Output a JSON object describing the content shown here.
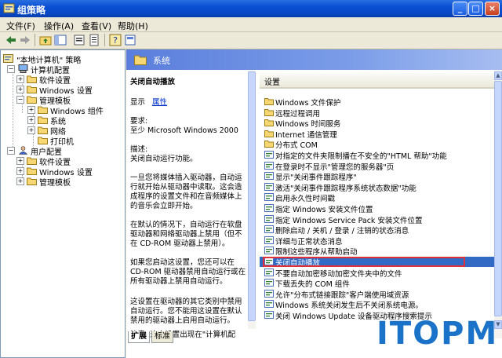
{
  "window": {
    "title": "组策略"
  },
  "menu": [
    "文件(F)",
    "操作(A)",
    "查看(V)",
    "帮助(H)"
  ],
  "toolbar_icons": [
    "back-icon",
    "forward-icon",
    "up-folder-icon",
    "show-tree-icon",
    "properties-icon",
    "export-icon",
    "help-icon",
    "view-icon"
  ],
  "tree": [
    {
      "label": "\"本地计算机\" 策略",
      "level": 0,
      "icon": "policy-icon",
      "expander": ""
    },
    {
      "label": "计算机配置",
      "level": 1,
      "icon": "computer-icon",
      "expander": "−"
    },
    {
      "label": "软件设置",
      "level": 2,
      "icon": "folder-icon",
      "expander": "+"
    },
    {
      "label": "Windows 设置",
      "level": 2,
      "icon": "folder-icon",
      "expander": "+"
    },
    {
      "label": "管理模板",
      "level": 2,
      "icon": "folder-icon",
      "expander": "−"
    },
    {
      "label": "Windows 组件",
      "level": 3,
      "icon": "folder-icon",
      "expander": "+"
    },
    {
      "label": "系统",
      "level": 3,
      "icon": "folder-icon",
      "expander": "+"
    },
    {
      "label": "网络",
      "level": 3,
      "icon": "folder-icon",
      "expander": "+"
    },
    {
      "label": "打印机",
      "level": 3,
      "icon": "folder-icon",
      "expander": ""
    },
    {
      "label": "用户配置",
      "level": 1,
      "icon": "user-icon",
      "expander": "−"
    },
    {
      "label": "软件设置",
      "level": 2,
      "icon": "folder-icon",
      "expander": "+"
    },
    {
      "label": "Windows 设置",
      "level": 2,
      "icon": "folder-icon",
      "expander": "+"
    },
    {
      "label": "管理模板",
      "level": 2,
      "icon": "folder-icon",
      "expander": "+"
    }
  ],
  "header": {
    "title": "系统"
  },
  "description": {
    "title": "关闭自动播放",
    "show_label": "显示",
    "properties_link": "属性",
    "requirements_label": "要求:",
    "requirements_value": "至少 Microsoft Windows 2000",
    "desc_label": "描述:",
    "desc_first": "关闭自动运行功能。",
    "para1": "一旦您将媒体插入驱动器，自动运行就开始从驱动器中读取。这会造成程序的设置文件和在音频媒体上的音乐会立即开始。",
    "para2": "在默认的情况下，自动运行在软盘驱动器和网络驱动器上禁用（但不在 CD-ROM 驱动器上禁用）。",
    "para3": "如果您启动这设置，您还可以在 CD-ROM 驱动器禁用自动运行或在所有驱动器上禁用自动运行。",
    "para4": "这设置在驱动器的其它类别中禁用自动运行。您不能用这设置在默认禁用的驱动器上启用自动运行。",
    "para5": "注意: 这个设置出现在\"计算机配"
  },
  "tabs": [
    "扩展",
    "标准"
  ],
  "list": {
    "column_header": "设置",
    "rows": [
      {
        "label": "Windows 文件保护",
        "icon": "folder"
      },
      {
        "label": "远程过程调用",
        "icon": "folder"
      },
      {
        "label": "Windows 时间服务",
        "icon": "folder"
      },
      {
        "label": "Internet 通信管理",
        "icon": "folder"
      },
      {
        "label": "分布式 COM",
        "icon": "folder"
      },
      {
        "label": "对指定的文件夹限制播在不安全的\"HTML 帮助\"功能",
        "icon": "setting"
      },
      {
        "label": "在登录时不显示\"管理您的服务器\"页",
        "icon": "setting"
      },
      {
        "label": "显示\"关闭事件跟踪程序\"",
        "icon": "setting"
      },
      {
        "label": "激活\"关闭事件跟踪程序系统状态数据\"功能",
        "icon": "setting"
      },
      {
        "label": "启用永久性时间戳",
        "icon": "setting"
      },
      {
        "label": "指定 Windows 安装文件位置",
        "icon": "setting"
      },
      {
        "label": "指定 Windows Service Pack 安装文件位置",
        "icon": "setting"
      },
      {
        "label": "删除启动 / 关机 / 登录 / 注销的状态消息",
        "icon": "setting"
      },
      {
        "label": "详细与正常状态消息",
        "icon": "setting"
      },
      {
        "label": "限制这些程序从帮助启动",
        "icon": "setting"
      },
      {
        "label": "关闭自动播放",
        "icon": "setting",
        "selected": true
      },
      {
        "label": "不要自动加密移动加密文件夹中的文件",
        "icon": "setting"
      },
      {
        "label": "下载丢失的 COM 组件",
        "icon": "setting"
      },
      {
        "label": "允许\"分布式链接跟踪\"客户端使用域资源",
        "icon": "setting"
      },
      {
        "label": "Windows 系统关闭发生后不关闭系统电源。",
        "icon": "setting"
      },
      {
        "label": "关闭 Windows Update 设备驱动程序搜索提示",
        "icon": "setting"
      }
    ]
  },
  "watermark": "ITOPM"
}
